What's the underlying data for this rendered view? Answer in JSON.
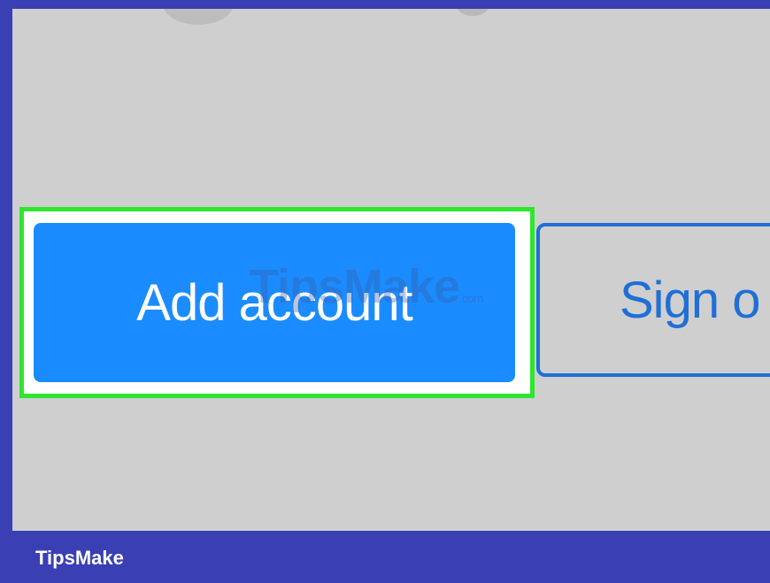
{
  "buttons": {
    "add_account_label": "Add account",
    "sign_out_label": "Sign o"
  },
  "watermark": {
    "text": "TipsMake",
    "suffix": ".com"
  },
  "footer": {
    "brand": "TipsMake"
  },
  "colors": {
    "frame": "#3b3fb4",
    "screen_background": "#cfcfcf",
    "highlight": "#2fe62f",
    "primary_button": "#1a8cff",
    "secondary_button_text": "#1f6fd6"
  }
}
